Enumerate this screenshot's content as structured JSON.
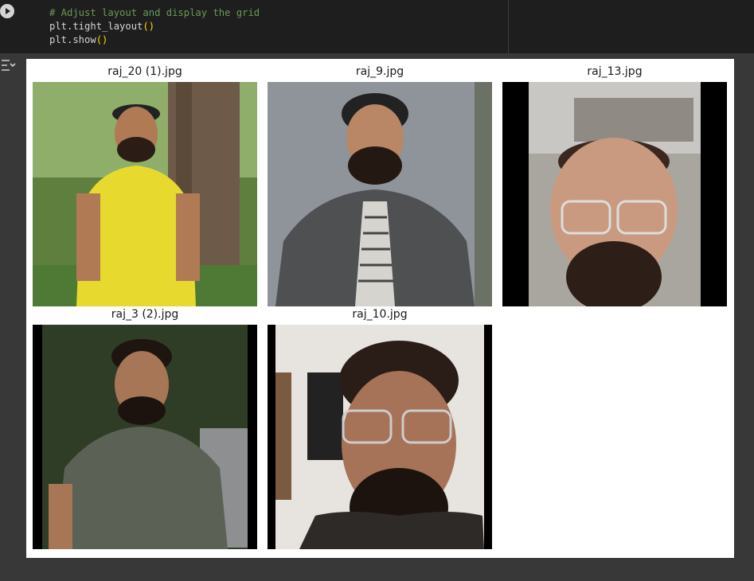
{
  "code_cell": {
    "lines": [
      {
        "kind": "comment",
        "text": "# Adjust layout and display the grid"
      },
      {
        "kind": "call",
        "name": "plt.tight_layout",
        "parens": "()"
      },
      {
        "kind": "call",
        "name": "plt.show",
        "parens": "()"
      }
    ]
  },
  "figure": {
    "tiles": [
      {
        "title": "raj_20 (1).jpg"
      },
      {
        "title": "raj_9.jpg"
      },
      {
        "title": "raj_13.jpg"
      },
      {
        "title": "raj_3 (2).jpg"
      },
      {
        "title": "raj_10.jpg"
      }
    ]
  },
  "colors": {
    "code_bg": "#1e1e1e",
    "page_bg": "#383838",
    "comment": "#6a9955",
    "paren": "#ffd700"
  },
  "icons": {
    "run": "run-cell-icon",
    "output": "output-toggle-icon"
  }
}
